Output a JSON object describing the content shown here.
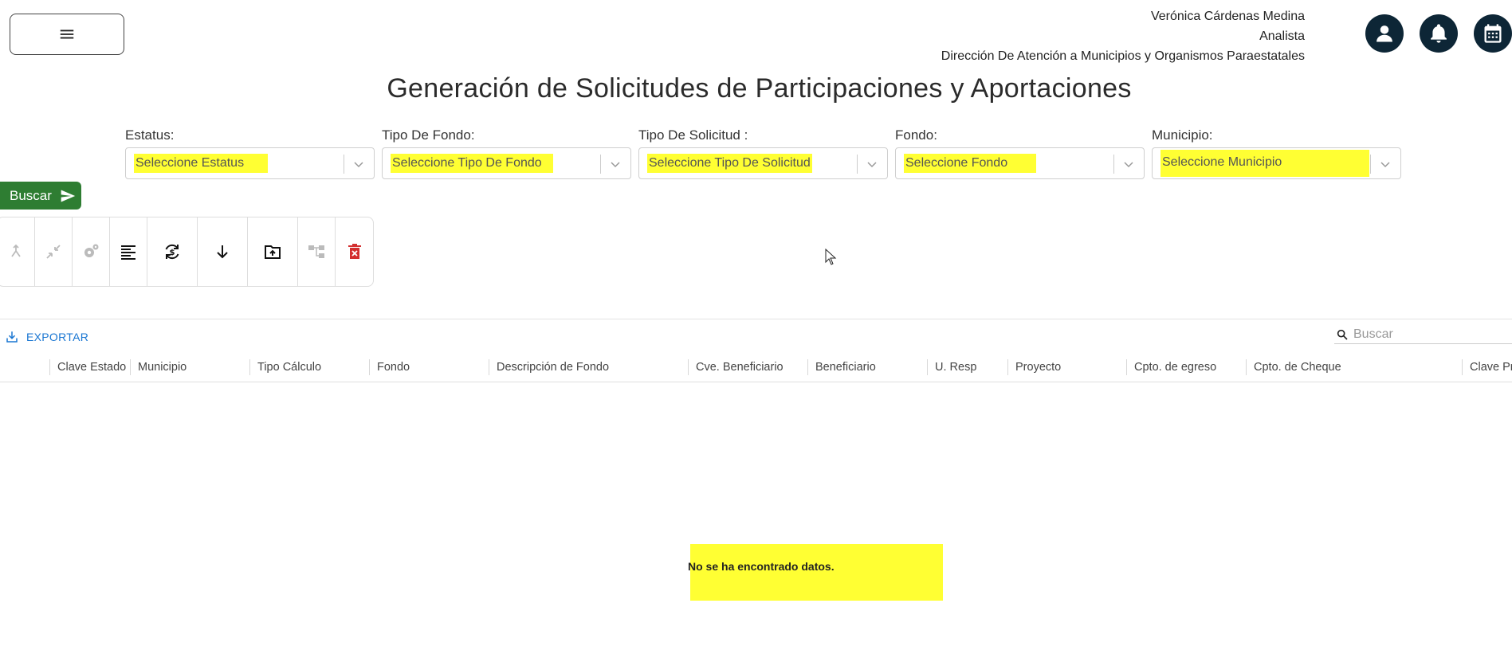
{
  "header": {
    "user_name": "Verónica Cárdenas Medina",
    "user_role": "Analista",
    "user_department": "Dirección De Atención a Municipios y Organismos Paraestatales",
    "icons": [
      "menu-icon",
      "account-icon",
      "bell-icon",
      "calendar-icon"
    ]
  },
  "page": {
    "title": "Generación de Solicitudes de Participaciones y Aportaciones"
  },
  "filters": [
    {
      "label": "Estatus:",
      "placeholder": "Seleccione Estatus"
    },
    {
      "label": "Tipo De Fondo:",
      "placeholder": "Seleccione Tipo De Fondo"
    },
    {
      "label": "Tipo De Solicitud :",
      "placeholder": "Seleccione Tipo De Solicitud"
    },
    {
      "label": "Fondo:",
      "placeholder": "Seleccione Fondo"
    },
    {
      "label": "Municipio:",
      "placeholder": "Seleccione Municipio"
    }
  ],
  "buscar_button": {
    "label": "Buscar",
    "icon": "send-icon"
  },
  "toolbar": [
    {
      "name": "merge-icon",
      "enabled": false
    },
    {
      "name": "compress-icon",
      "enabled": false
    },
    {
      "name": "settings-gear-icon",
      "enabled": false
    },
    {
      "name": "align-text-icon",
      "enabled": true
    },
    {
      "name": "currency-sync-icon",
      "enabled": true
    },
    {
      "name": "arrow-down-icon",
      "enabled": true
    },
    {
      "name": "folder-upload-icon",
      "enabled": true
    },
    {
      "name": "hierarchy-icon",
      "enabled": false
    },
    {
      "name": "delete-icon",
      "enabled": true
    }
  ],
  "table": {
    "export_label": "EXPORTAR",
    "search_placeholder": "Buscar",
    "columns": [
      "Clave Estado",
      "Municipio",
      "Tipo Cálculo",
      "Fondo",
      "Descripción de Fondo",
      "Cve. Beneficiario",
      "Beneficiario",
      "U. Resp",
      "Proyecto",
      "Cpto. de egreso",
      "Cpto. de Cheque",
      "Clave Pr"
    ],
    "empty_message": "No se ha encontrado datos."
  },
  "colors": {
    "header_icon_bg": "#0d2636",
    "buscar_bg": "#2e7d32",
    "highlight": "#ffff33",
    "link_blue": "#1976d2",
    "delete_red": "#d32f2f"
  }
}
